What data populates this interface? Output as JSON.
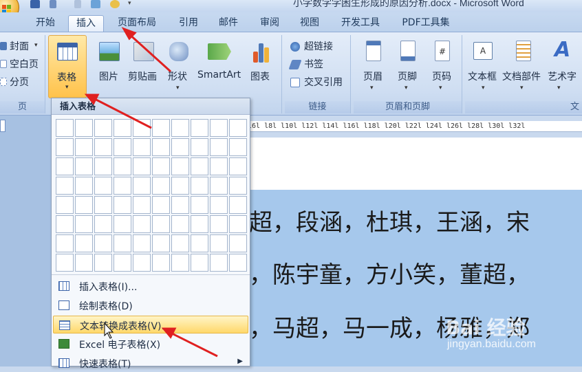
{
  "window": {
    "title": "小学数学学困生形成的原因分析.docx - Microsoft Word"
  },
  "tabs": [
    {
      "label": "开始"
    },
    {
      "label": "插入"
    },
    {
      "label": "页面布局"
    },
    {
      "label": "引用"
    },
    {
      "label": "邮件"
    },
    {
      "label": "审阅"
    },
    {
      "label": "视图"
    },
    {
      "label": "开发工具"
    },
    {
      "label": "PDF工具集"
    }
  ],
  "ribbon": {
    "pages_group": {
      "cover": "封面",
      "blank_page": "空白页",
      "page_break": "分页",
      "label": "页"
    },
    "table_button": "表格",
    "illustrations": {
      "picture": "图片",
      "clipart": "剪贴画",
      "shapes": "形状",
      "smartart": "SmartArt",
      "chart": "图表"
    },
    "links": {
      "hyperlink": "超链接",
      "bookmark": "书签",
      "cross_ref": "交叉引用",
      "label": "链接"
    },
    "header_footer": {
      "header": "页眉",
      "footer": "页脚",
      "page_number": "页码",
      "label": "页眉和页脚"
    },
    "text": {
      "textbox": "文本框",
      "quickparts": "文档部件",
      "wordart": "艺术字",
      "label": "文"
    }
  },
  "ruler_text": "l6l  l8l  l10l  l12l  l14l  l16l  l18l  l20l  l22l  l24l  l26l  l28l  l30l  l32l",
  "dropdown": {
    "header": "插入表格",
    "items": [
      {
        "label": "插入表格(I)..."
      },
      {
        "label": "绘制表格(D)"
      },
      {
        "label": "文本转换成表格(V)..."
      },
      {
        "label": "Excel 电子表格(X)"
      },
      {
        "label": "快速表格(T)"
      }
    ]
  },
  "document": {
    "lines": [
      "超，段涵，杜琪，王涵，宋",
      "，陈宇童，方小笑，董超，",
      "，马超，马一成，杨雅，郑"
    ]
  },
  "watermark": {
    "brand": "Bai 经验",
    "url": "jingyan.baidu.com"
  },
  "colors": {
    "ribbon_bg": "#dce8f6",
    "active_tab": "#ffffff",
    "highlight": "#ffd86a",
    "selection": "#a6c8ec",
    "arrow": "#e02020"
  }
}
